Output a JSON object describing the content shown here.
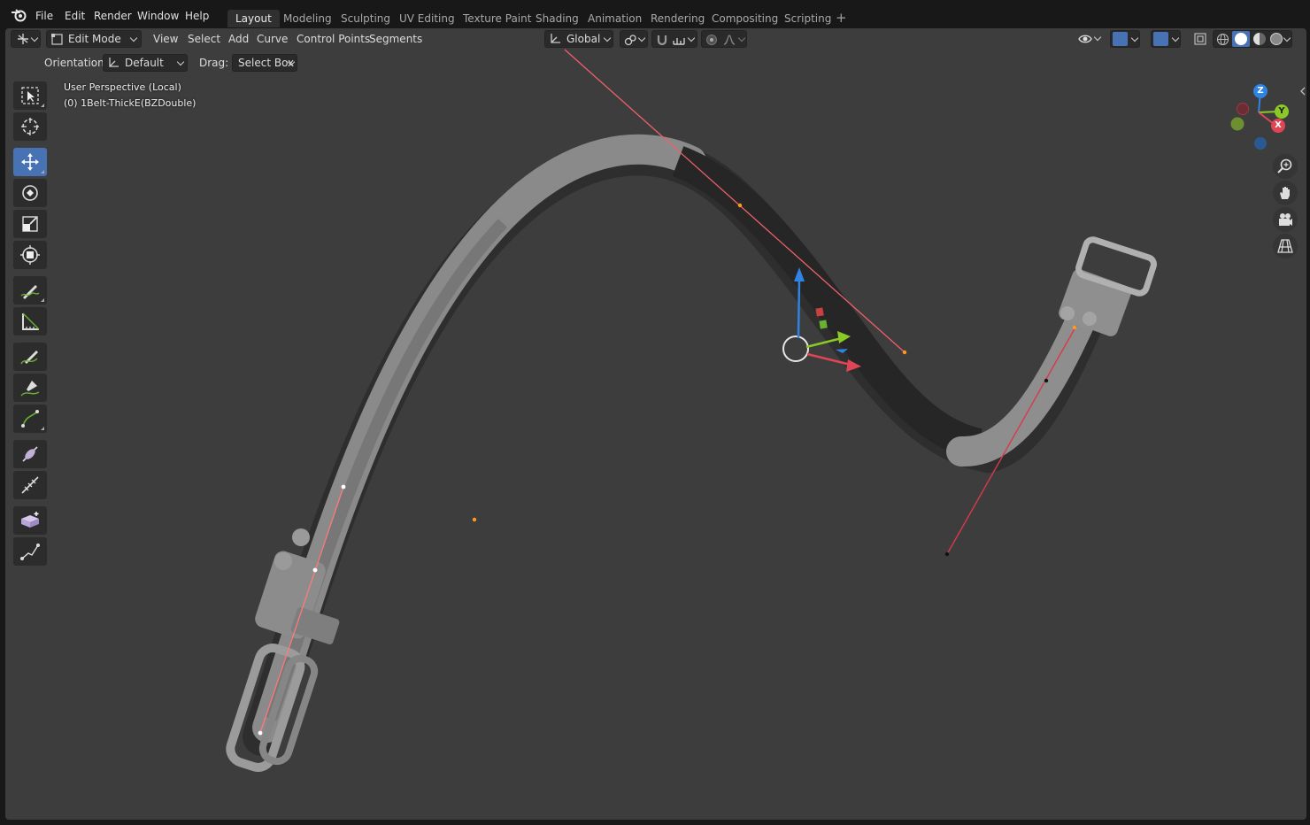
{
  "menubar": {
    "items": [
      "File",
      "Edit",
      "Render",
      "Window",
      "Help"
    ]
  },
  "workspaces": {
    "tabs": [
      "Layout",
      "Modeling",
      "Sculpting",
      "UV Editing",
      "Texture Paint",
      "Shading",
      "Animation",
      "Rendering",
      "Compositing",
      "Scripting"
    ],
    "active": "Layout",
    "add_icon": "plus-icon"
  },
  "header": {
    "mode": "Edit Mode",
    "menus": [
      "View",
      "Select",
      "Add",
      "Curve",
      "Control Points",
      "Segments"
    ],
    "transform_orientation": "Global",
    "orientation_label": "Orientation:",
    "orientation_value": "Default",
    "drag_label": "Drag:",
    "drag_value": "Select Box"
  },
  "overlay": {
    "view_name": "User Perspective (Local)",
    "object_name": "(0) 1Belt-ThickE(BZDouble)"
  },
  "gizmo": {
    "axes": [
      "Z",
      "Y",
      "X"
    ]
  },
  "colors": {
    "accent": "#4772b3",
    "axis_x": "#e04556",
    "axis_y": "#8ac926",
    "axis_z": "#2f84e3",
    "handle_line": "#f0606a",
    "selected_point": "#ff9a1f"
  },
  "tools": [
    "select-box-icon",
    "cursor-icon",
    "move-icon",
    "rotate-icon",
    "scale-icon",
    "transform-icon",
    "annotate-icon",
    "measure-icon",
    "draw-icon",
    "pen-icon",
    "curve-pen-icon",
    "tilt-icon",
    "radius-icon",
    "extrude-icon",
    "randomize-icon"
  ]
}
